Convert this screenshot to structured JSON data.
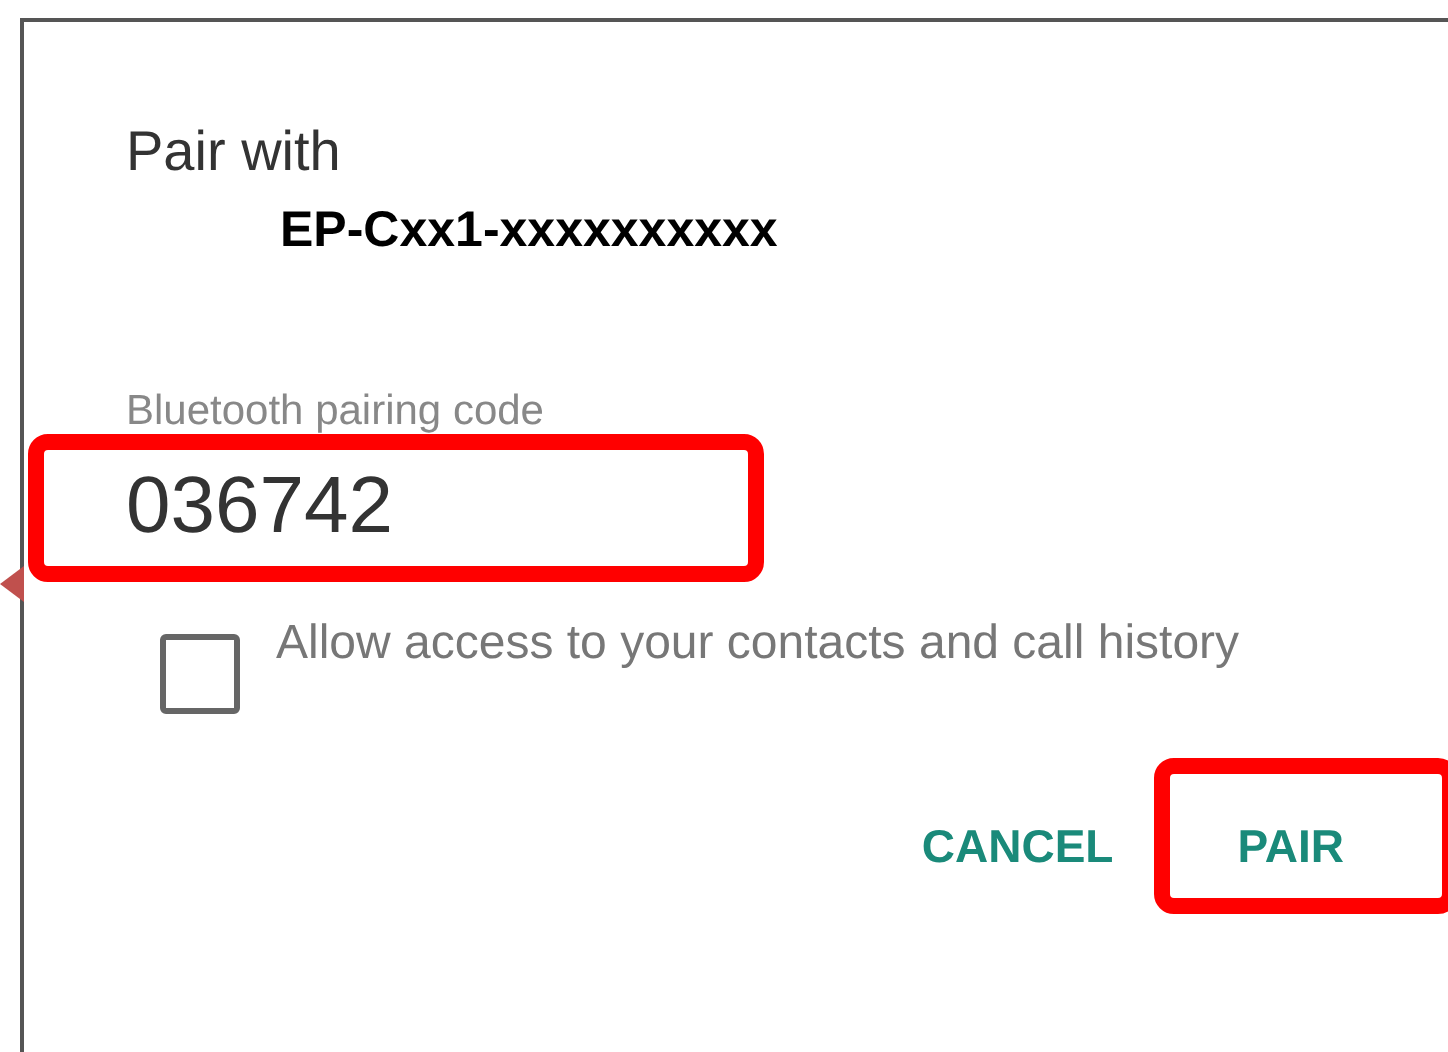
{
  "dialog": {
    "title": "Pair with",
    "device_name": "EP-Cxx1-xxxxxxxxxx"
  },
  "code_field": {
    "label": "Bluetooth pairing code",
    "value": "036742",
    "highlighted": true,
    "arrow": true
  },
  "checkbox": {
    "label": "Allow access to your contacts and call history",
    "checked": false
  },
  "buttons": [
    {
      "label": "CANCEL",
      "highlighted": false
    },
    {
      "label": "PAIR",
      "highlighted": true
    }
  ]
}
